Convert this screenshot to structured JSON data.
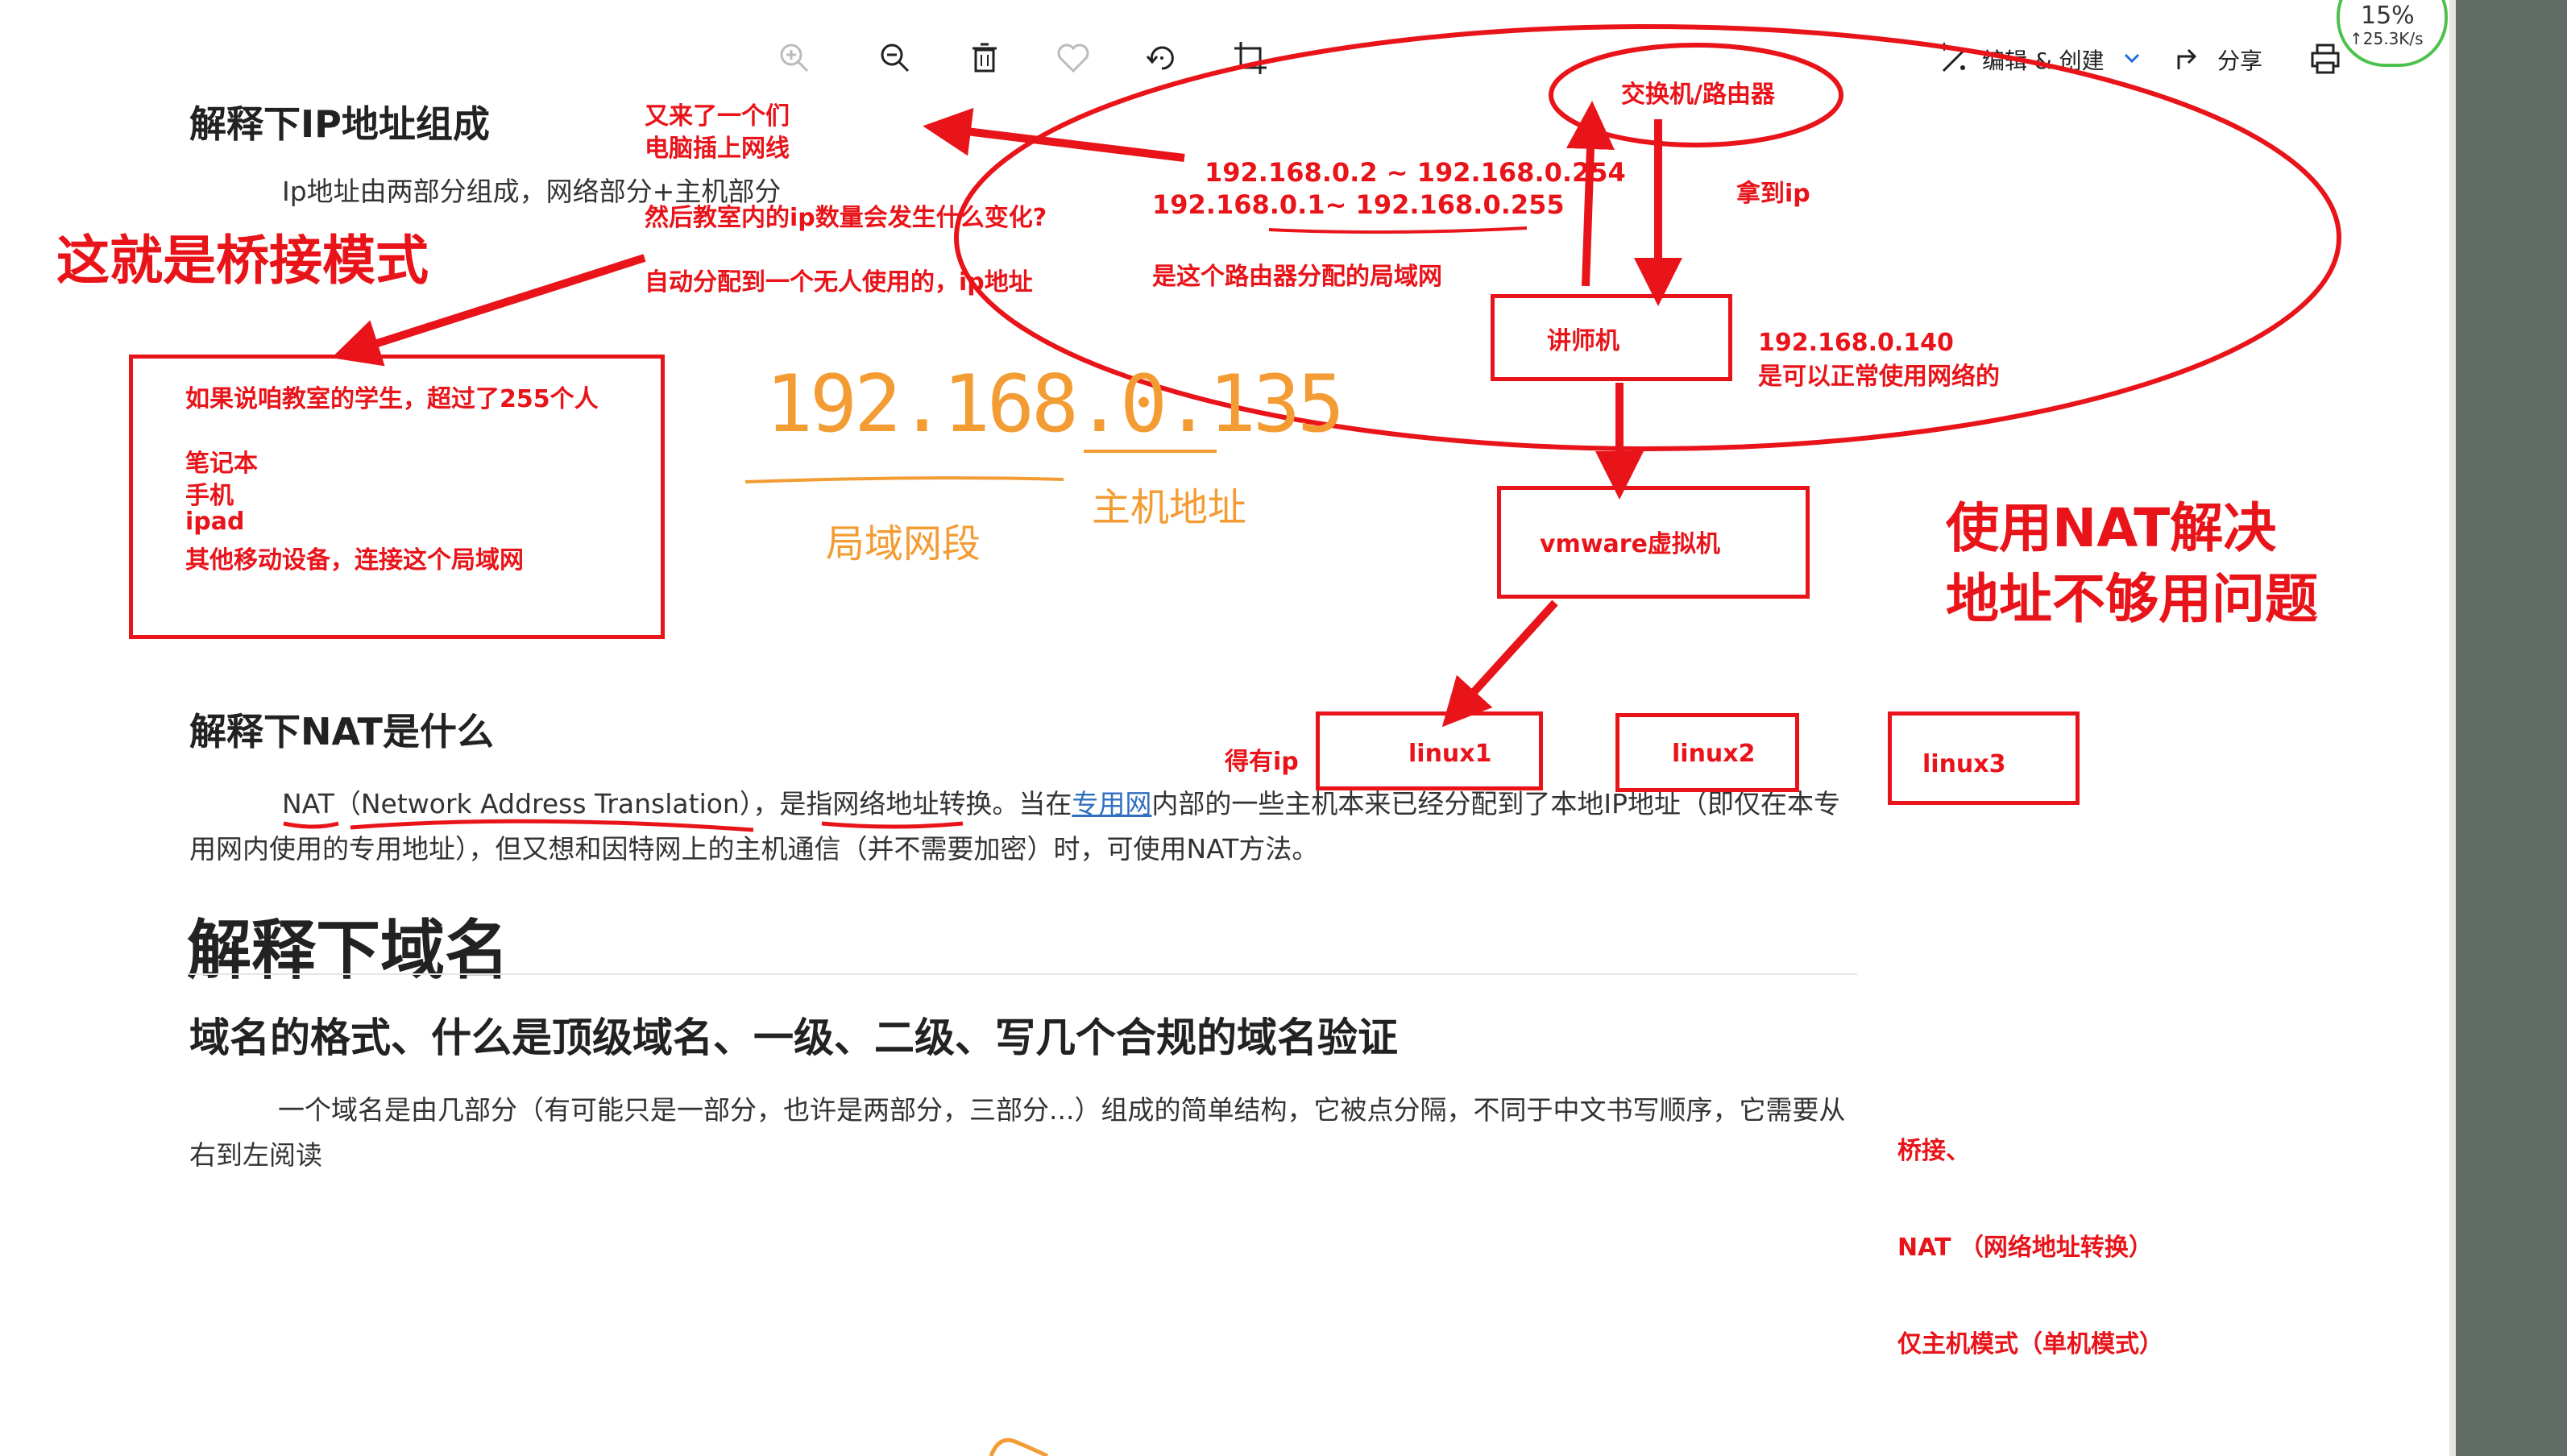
{
  "toolbar": {
    "edit_label": "编辑 & 创建",
    "share_label": "分享",
    "speed_percent": "15%",
    "speed_rate": "↑25.3K/s"
  },
  "doc": {
    "h_ip": "解释下IP地址组成",
    "p_ip": "Ip地址由两部分组成，网络部分+主机部分",
    "h_nat": "解释下NAT是什么",
    "p_nat_a": "NAT（Network Address Translation），是指网络地址转换。当在",
    "p_nat_link": "专用网",
    "p_nat_b": "内部的一些主机本来已经分配到了本地IP地址（即仅在本专用网内使用的专用地址），但又想和因特网上的主机通信（并不需要加密）时，可使用NAT方法。",
    "h_domain": "解释下域名",
    "h_domain_format": "域名的格式、什么是顶级域名、一级、二级、写几个合规的域名验证",
    "p_domain": "一个域名是由几部分（有可能只是一部分，也许是两部分，三部分...）组成的简单结构，它被点分隔，不同于中文书写顺序，它需要从右到左阅读"
  },
  "annotations": {
    "new_people_1": "又来了一个们",
    "new_people_2": "电脑插上网线",
    "what_changes": "然后教室内的ip数量会发生什么变化?",
    "auto_assign": "自动分配到一个无人使用的，ip地址",
    "bridge_mode": "这就是桥接模式",
    "box_students": "如果说咱教室的学生，超过了255个人",
    "notebook": "笔记本",
    "phone": "手机",
    "ipad": "ipad",
    "other_devices": "其他移动设备，连接这个局域网",
    "handwritten_ip": "192.168.0.135",
    "lan_segment": "局域网段",
    "host_address": "主机地址",
    "switch_router": "交换机/路由器",
    "range_1": "192.168.0.2 ~ 192.168.0.254",
    "range_2": "192.168.0.1~ 192.168.0.255",
    "router_lan": "是这个路由器分配的局域网",
    "get_ip_1": "拿到ip",
    "teacher": "讲师机",
    "teacher_ip": "192.168.0.140",
    "teacher_ok": "是可以正常使用网络的",
    "vmware": "vmware虚拟机",
    "nat_solve_1": "使用NAT解决",
    "nat_solve_2": "地址不够用问题",
    "get_ip_2": "得有ip",
    "linux1": "linux1",
    "linux2": "linux2",
    "linux3": "linux3",
    "mode_bridge": "桥接、",
    "mode_nat": "NAT （网络地址转换）",
    "mode_host": "仅主机模式（单机模式）"
  },
  "colors": {
    "annotation_red": "#e8141a",
    "handwriting_orange": "#f39c34",
    "link_blue": "#2f6fbf",
    "panel_gray": "#5f6b63"
  }
}
